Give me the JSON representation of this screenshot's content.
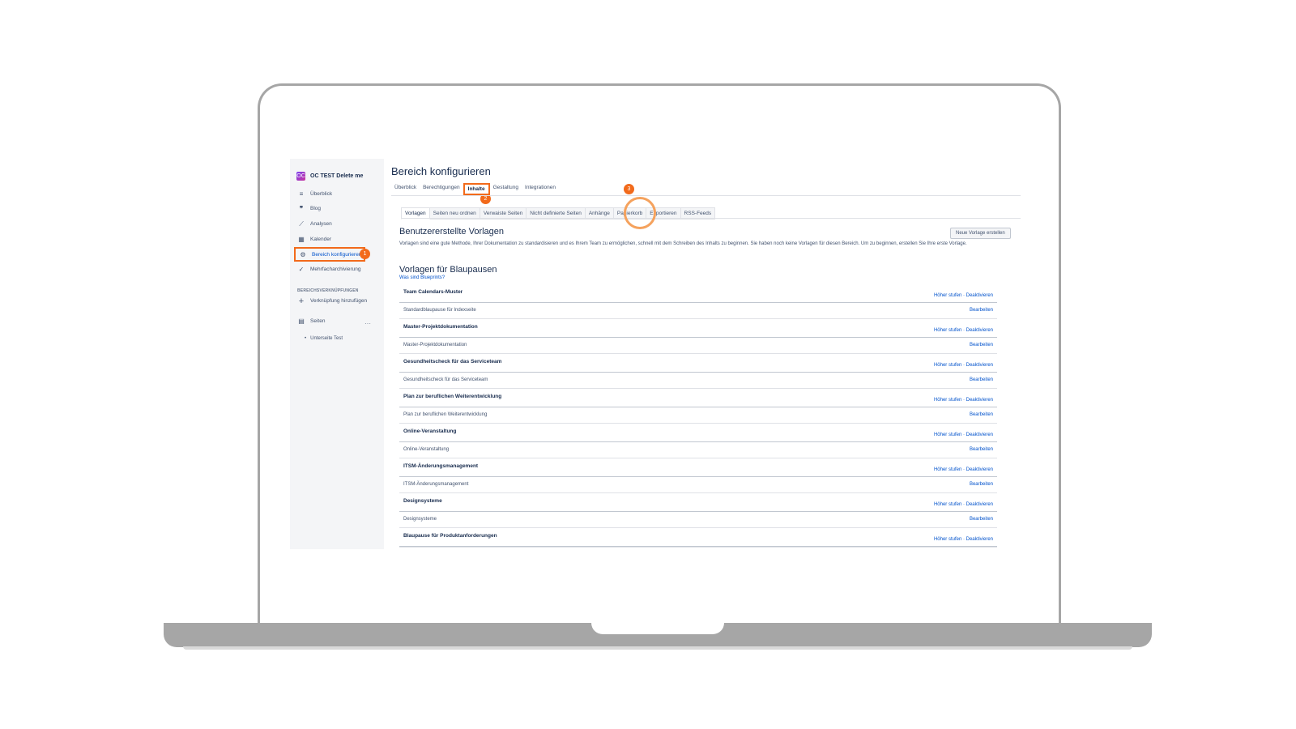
{
  "sidebar": {
    "space_logo": "OC",
    "space_name": "OC TEST Delete me",
    "items": [
      {
        "label": "Überblick",
        "icon": "overview-icon"
      },
      {
        "label": "Blog",
        "icon": "quote-icon"
      },
      {
        "label": "Analysen",
        "icon": "chart-icon"
      },
      {
        "label": "Kalender",
        "icon": "calendar-icon"
      },
      {
        "label": "Bereich konfigurieren",
        "icon": "gear-icon"
      },
      {
        "label": "Mehrfacharchivierung",
        "icon": "archive-icon"
      }
    ],
    "shortcuts_heading": "BEREICHSVERKNÜPFUNGEN",
    "add_shortcut": "Verknüpfung hinzufügen",
    "pages_label": "Seiten",
    "pages_more": "···",
    "sub_page": "Unterseite Test"
  },
  "badges": [
    "1",
    "2",
    "3"
  ],
  "main": {
    "title": "Bereich konfigurieren",
    "tabs": [
      "Überblick",
      "Berechtigungen",
      "Inhalte",
      "Gestaltung",
      "Integrationen"
    ],
    "subtabs": [
      "Vorlagen",
      "Seiten neu ordnen",
      "Verwaiste Seiten",
      "Nicht definierte Seiten",
      "Anhänge",
      "Papierkorb",
      "Exportieren",
      "RSS-Feeds"
    ],
    "user_templates_heading": "Benutzererstellte Vorlagen",
    "new_template_button": "Neue Vorlage erstellen",
    "description": "Vorlagen sind eine gute Methode, Ihrer Dokumentation zu standardisieren und es Ihrem Team zu ermöglichen, schnell mit dem Schreiben des Inhalts zu beginnen. Sie haben noch keine Vorlagen für diesen Bereich. Um zu beginnen, erstellen Sie Ihre erste Vorlage.",
    "blueprint_heading": "Vorlagen für Blaupausen",
    "blueprint_link": "Was sind Blueprints?",
    "actions_label": "Höher stufen · Deaktivieren",
    "edit_label": "Bearbeiten",
    "blueprints": [
      {
        "name": "Team Calendars-Muster",
        "sub": "Standardblaupause für Indexseite"
      },
      {
        "name": "Master-Projektdokumentation",
        "sub": "Master-Projektdokumentation"
      },
      {
        "name": "Gesundheitscheck für das Serviceteam",
        "sub": "Gesundheitscheck für das Serviceteam"
      },
      {
        "name": "Plan zur beruflichen Weiterentwicklung",
        "sub": "Plan zur beruflichen Weiterentwicklung"
      },
      {
        "name": "Online-Veranstaltung",
        "sub": "Online-Veranstaltung"
      },
      {
        "name": "ITSM-Änderungsmanagement",
        "sub": "ITSM-Änderungsmanagement"
      },
      {
        "name": "Designsysteme",
        "sub": "Designsysteme"
      },
      {
        "name": "Blaupause für Produktanforderungen",
        "sub": ""
      }
    ]
  },
  "colors": {
    "highlight": "#f26a1b",
    "link": "#0052cc",
    "sidebar": "#f4f5f7"
  }
}
